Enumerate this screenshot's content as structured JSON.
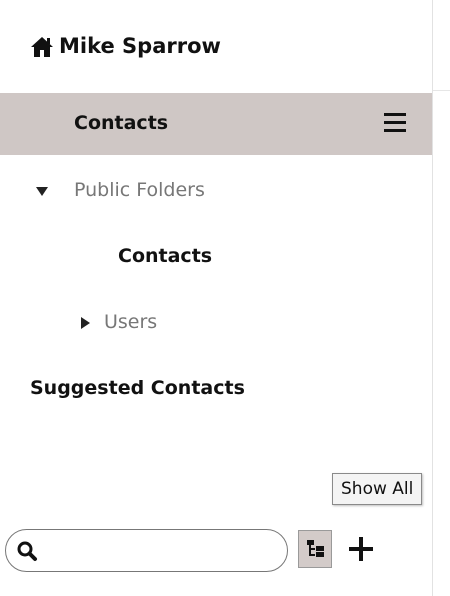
{
  "account": {
    "name": "Mike Sparrow",
    "icon": "home-icon"
  },
  "folders": [
    {
      "label": "Contacts",
      "selected": true,
      "icon": "hamburger-menu-icon"
    },
    {
      "label": "Public Folders",
      "expanded": true,
      "icon": "caret-down-icon"
    },
    {
      "label": "Contacts"
    },
    {
      "label": "Users",
      "expanded": false,
      "icon": "caret-right-icon"
    },
    {
      "label": "Suggested Contacts"
    }
  ],
  "tooltip": {
    "text": "Show All"
  },
  "search": {
    "value": "",
    "placeholder": "",
    "icon": "search-icon"
  },
  "toolbar": {
    "tree_toggle_icon": "folder-tree-icon",
    "add_icon": "plus-icon"
  },
  "colors": {
    "selected_row": "#cfc7c5",
    "toggle_active": "#d3cbc9",
    "muted_text": "#777777"
  }
}
